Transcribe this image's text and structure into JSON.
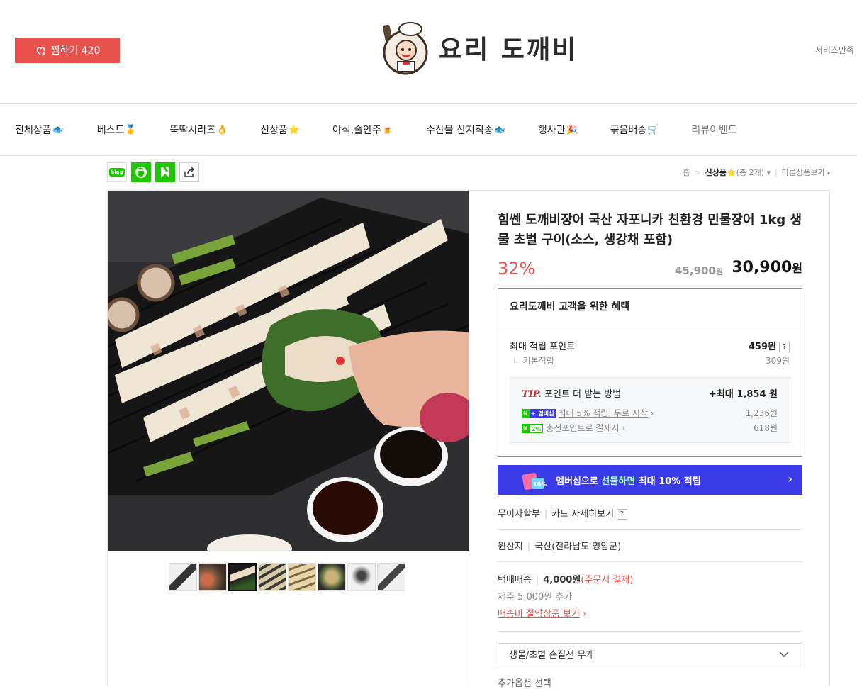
{
  "header": {
    "wish_label": "찜하기 420",
    "logo_text": "요리 도깨비",
    "service_text": "서비스만족"
  },
  "gnb": {
    "items": [
      {
        "label": "전체상품",
        "emoji": "🐟"
      },
      {
        "label": "베스트",
        "emoji": "🥇"
      },
      {
        "label": "뚝딱시리즈",
        "emoji": "👌"
      },
      {
        "label": "신상품",
        "emoji": "⭐"
      },
      {
        "label": "야식,술안주",
        "emoji": "🍺"
      },
      {
        "label": "수산물 산지직송",
        "emoji": "🐟"
      },
      {
        "label": "행사관",
        "emoji": "🎉"
      },
      {
        "label": "묶음배송",
        "emoji": "🛒"
      },
      {
        "label": "리뷰이벤트",
        "emoji": ""
      }
    ]
  },
  "sns": {
    "blog_label": "blog"
  },
  "breadcrumb": {
    "home": "홈",
    "category": "신상품",
    "count": "(총 2개)",
    "other": "다른상품보기"
  },
  "product": {
    "title": "힘쎈 도깨비장어 국산 자포니카 친환경 민물장어 1kg 생물 초벌 구이(소스, 생강채 포함)",
    "discount": "32%",
    "original_price": "45,900",
    "original_unit": "원",
    "sale_price": "30,900",
    "sale_unit": "원"
  },
  "benefit": {
    "title": "요리도깨비 고객을 위한 혜택",
    "max_point_label": "최대 적립 포인트",
    "max_point_value": "459원",
    "basic_label": "기본적립",
    "basic_value": "309원",
    "tip_prefix": "TIP.",
    "tip_label": "포인트 더 받는 방법",
    "tip_max": "+최대 1,854 원",
    "tip_rows": [
      {
        "badge": "멤버십",
        "text": "최대 5% 적립, 무료 시작",
        "value": "1,236원"
      },
      {
        "badge": "2%",
        "text": "충전포인트로 결제시",
        "value": "618원"
      }
    ]
  },
  "membership_banner": {
    "pre": "멤버십으로 ",
    "em": "선물하면",
    "post": " 최대 10% 적립",
    "gift_badge": "10%"
  },
  "payment": {
    "installment": "무이자할부",
    "card_detail": "카드 자세히보기"
  },
  "origin": {
    "label": "원산지",
    "value": "국산(전라남도 영암군)"
  },
  "shipping": {
    "label": "택배배송",
    "fee": "4,000원",
    "fee_note": "(주문시 결제)",
    "jeju": "제주 5,000원 추가",
    "save_link": "배송비 절약상품 보기"
  },
  "option": {
    "select_label": "생물/초벌 손질전 무게",
    "extra_label": "추가옵션 선택"
  },
  "colors": {
    "accent": "#e9524d",
    "membership": "#3a3ae6",
    "naver_green": "#1ec800"
  }
}
